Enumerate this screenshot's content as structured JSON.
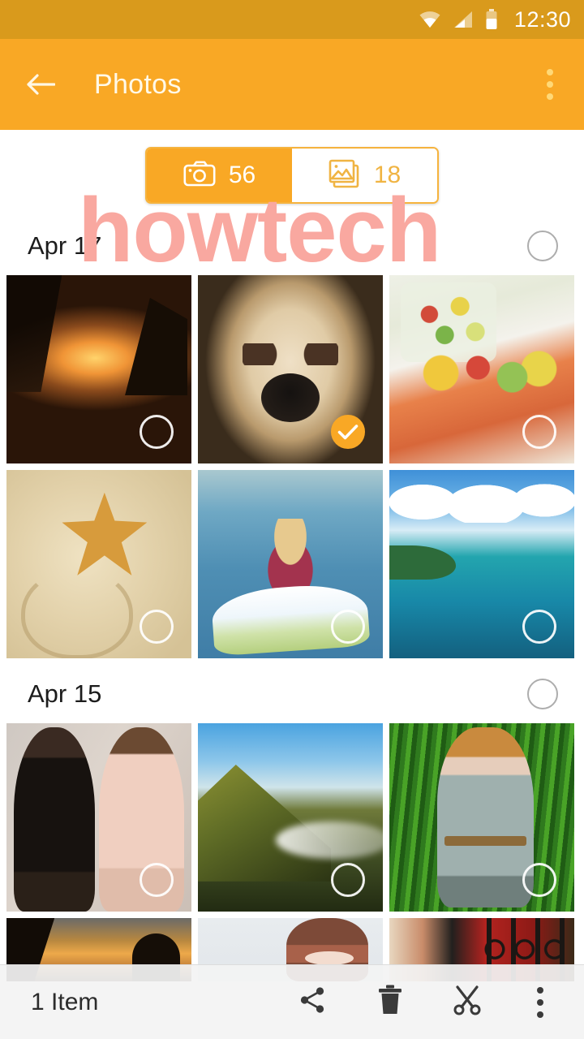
{
  "status_bar": {
    "time": "12:30",
    "icons": [
      "wifi-icon",
      "cellular-signal-icon",
      "battery-icon"
    ],
    "background": "#d99a1c"
  },
  "app_bar": {
    "title": "Photos",
    "back_label": "Back",
    "overflow_label": "More options",
    "background": "#f9a825"
  },
  "tabs": [
    {
      "id": "camera",
      "icon": "camera-icon",
      "count": "56",
      "active": true
    },
    {
      "id": "gallery",
      "icon": "gallery-icon",
      "count": "18",
      "active": false
    }
  ],
  "accent_color": "#f9a825",
  "watermark": {
    "text": "howtech",
    "color": "#f9a8a0"
  },
  "sections": [
    {
      "date": "Apr 17",
      "rows": [
        [
          {
            "name": "sunset-beach",
            "art": "art-sunset-beach",
            "selected": false
          },
          {
            "name": "pug-dog",
            "art": "art-pug",
            "selected": true
          },
          {
            "name": "salmon-salad-plate",
            "art": "art-salmon",
            "selected": false
          }
        ],
        [
          {
            "name": "starfish-sand-heart",
            "art": "art-starfish",
            "selected": false
          },
          {
            "name": "baby-on-surfboard",
            "art": "art-surf",
            "selected": false
          },
          {
            "name": "tropical-ocean-coast",
            "art": "art-ocean",
            "selected": false
          }
        ]
      ]
    },
    {
      "date": "Apr 15",
      "rows": [
        [
          {
            "name": "two-women-dresses",
            "art": "art-women",
            "selected": false
          },
          {
            "name": "mountain-landscape",
            "art": "art-mountain",
            "selected": false
          },
          {
            "name": "woman-lying-in-grass",
            "art": "art-grass",
            "selected": false
          }
        ]
      ],
      "partial_row": [
        {
          "name": "sunset-silhouette",
          "art": "art-sunset2"
        },
        {
          "name": "woman-portrait",
          "art": "art-portrait"
        },
        {
          "name": "red-gate",
          "art": "art-redgate"
        }
      ]
    }
  ],
  "bottom_bar": {
    "count_label": "1 Item",
    "actions": [
      {
        "id": "share",
        "icon": "share-icon",
        "label": "Share"
      },
      {
        "id": "delete",
        "icon": "trash-icon",
        "label": "Delete"
      },
      {
        "id": "cut",
        "icon": "scissors-icon",
        "label": "Cut"
      },
      {
        "id": "more",
        "icon": "overflow-menu-icon",
        "label": "More"
      }
    ]
  }
}
